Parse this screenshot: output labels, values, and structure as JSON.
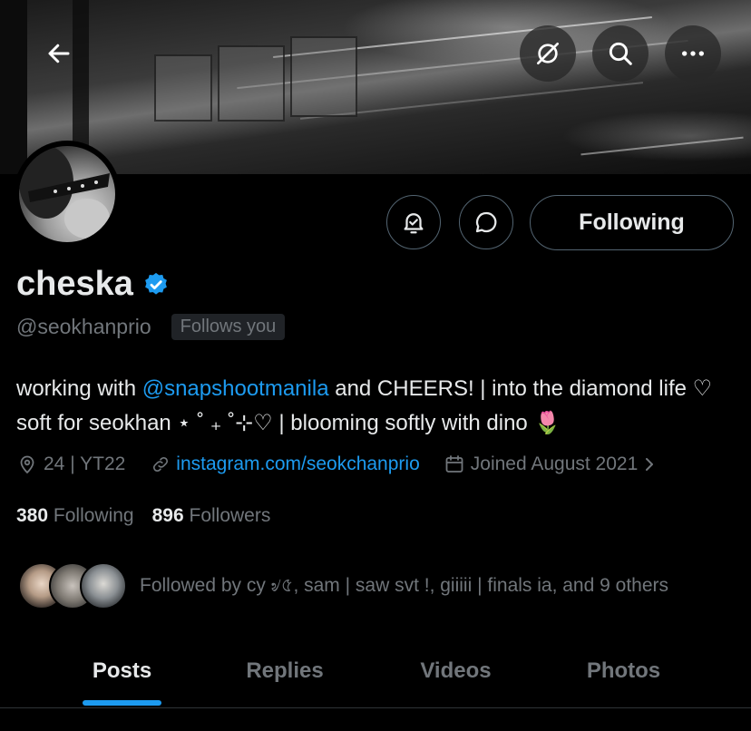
{
  "header": {
    "back_icon": "arrow-left-icon",
    "actions": [
      {
        "icon": "unlink-icon"
      },
      {
        "icon": "search-icon"
      },
      {
        "icon": "more-icon"
      }
    ]
  },
  "profile": {
    "display_name": "cheska",
    "verified": true,
    "handle": "@seokhanprio",
    "follows_you": "Follows you",
    "bio": {
      "part1": "working with ",
      "mention": "@snapshootmanila",
      "part2": " and CHEERS! | into the diamond life ♡ soft for seokhan ⋆ ˚ ₊ ˚⊹♡ | blooming softly with dino 🌷"
    },
    "location": "24 | YT22",
    "website": "instagram.com/seokchanprio",
    "joined": "Joined August 2021",
    "following_count": "380",
    "following_label": "Following",
    "followers_count": "896",
    "followers_label": "Followers",
    "followed_by": "Followed by cy ৶৫, sam | saw svt !, giiiii | finals ia, and 9 others"
  },
  "actions": {
    "notify_icon": "bell-check-icon",
    "message_icon": "message-icon",
    "follow_button": "Following"
  },
  "tabs": [
    {
      "label": "Posts",
      "active": true
    },
    {
      "label": "Replies",
      "active": false
    },
    {
      "label": "Videos",
      "active": false
    },
    {
      "label": "Photos",
      "active": false
    }
  ],
  "colors": {
    "accent": "#1d9bf0",
    "text": "#e7e9ea",
    "muted": "#71767b",
    "border": "#536471",
    "background": "#000000"
  }
}
